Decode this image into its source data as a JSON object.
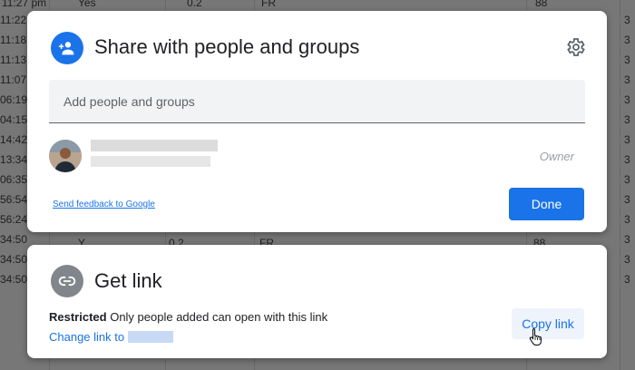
{
  "background_sheet": {
    "left_times": [
      "11:27 pm",
      "11:22",
      "11:18",
      "11:13",
      "11:07",
      "06:19",
      "04:15",
      "14:42",
      "13:34",
      "06:35",
      "56:54",
      "56:24",
      "34:50",
      "34:50",
      "34:50"
    ],
    "top_row": [
      "Yes",
      "0.2",
      "FR",
      "88"
    ],
    "right_digits": [
      "3",
      "3",
      "3",
      "3",
      "3",
      "3",
      "3",
      "3",
      "3",
      "3",
      "3",
      "3",
      "3",
      "3"
    ],
    "row12": [
      "Y",
      "0.2",
      "FR",
      "88"
    ]
  },
  "share_dialog": {
    "title": "Share with people and groups",
    "input_placeholder": "Add people and groups",
    "owner_role": "Owner",
    "feedback_link": "Send feedback to Google",
    "done_label": "Done"
  },
  "link_dialog": {
    "title": "Get link",
    "restricted_label": "Restricted",
    "restricted_desc": "Only people added can open with this link",
    "change_link_label": "Change link to",
    "copy_link_label": "Copy link"
  },
  "colors": {
    "accent_blue": "#1a73e8",
    "link_icon_gray": "#5f6368"
  },
  "icons": {
    "share_icon": "person-add-icon",
    "settings_icon": "gear-icon",
    "link_icon": "link-icon",
    "cursor": "hand-pointer-icon"
  }
}
